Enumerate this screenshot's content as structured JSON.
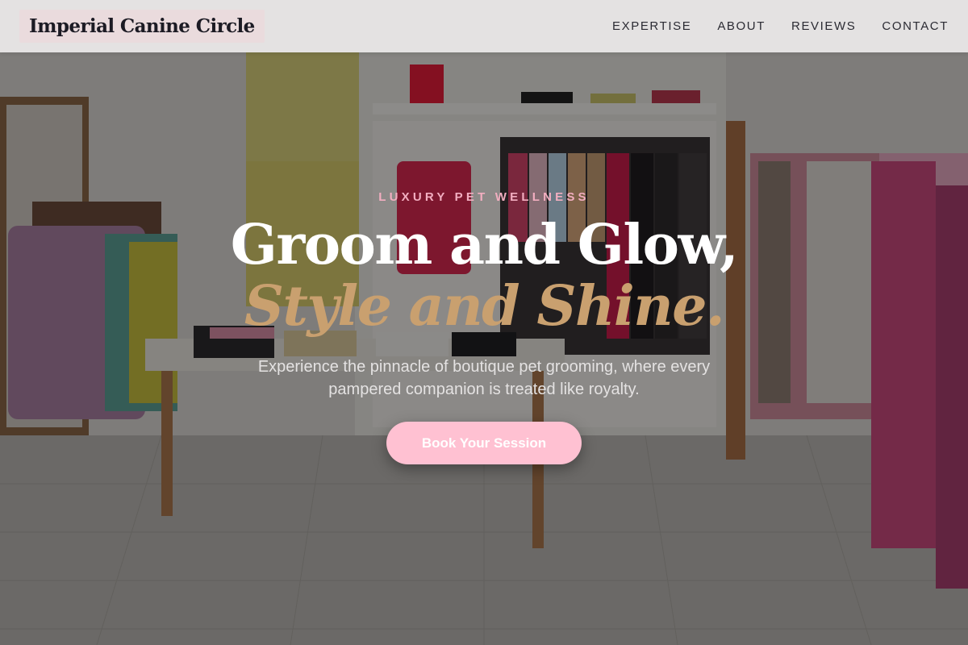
{
  "header": {
    "brand": "Imperial Canine Circle",
    "nav": [
      {
        "label": "EXPERTISE"
      },
      {
        "label": "ABOUT"
      },
      {
        "label": "REVIEWS"
      },
      {
        "label": "CONTACT"
      }
    ]
  },
  "hero": {
    "eyebrow": "LUXURY PET WELLNESS",
    "headline_line1": "Groom and Glow,",
    "headline_line2": "Style and Shine.",
    "subtext": "Experience the pinnacle of boutique pet grooming, where every pampered companion is treated like royalty.",
    "cta_label": "Book Your Session",
    "background_image": "boutique-clothing-store-photo"
  },
  "colors": {
    "header_bg": "#eceaea",
    "brand_highlight": "#eadbdd",
    "eyebrow": "#f2aec0",
    "headline": "#ffffff",
    "headline_accent": "#c9a06f",
    "cta_bg": "#ffc1d2"
  }
}
